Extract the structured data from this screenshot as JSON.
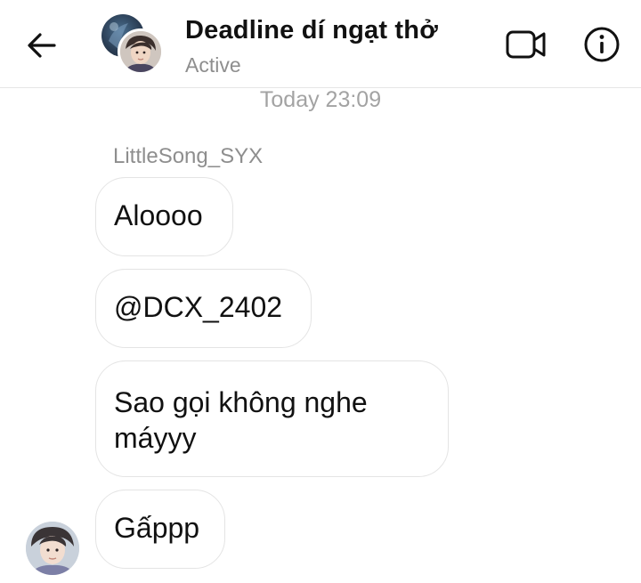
{
  "header": {
    "title": "Deadline dí ngạt thở",
    "status": "Active",
    "back_icon": "arrow-left-icon",
    "video_icon": "video-camera-icon",
    "info_icon": "info-icon"
  },
  "conversation": {
    "timestamp": "Today 23:09",
    "sender": "LittleSong_SYX",
    "messages": [
      {
        "text": "Aloooo"
      },
      {
        "text": "@DCX_2402"
      },
      {
        "text": "Sao gọi không nghe máyyy"
      },
      {
        "text": "Gấppp"
      }
    ]
  },
  "colors": {
    "title": "#111111",
    "muted": "#8e8e8e",
    "bubble_border": "#e4e4e4",
    "background": "#ffffff"
  }
}
